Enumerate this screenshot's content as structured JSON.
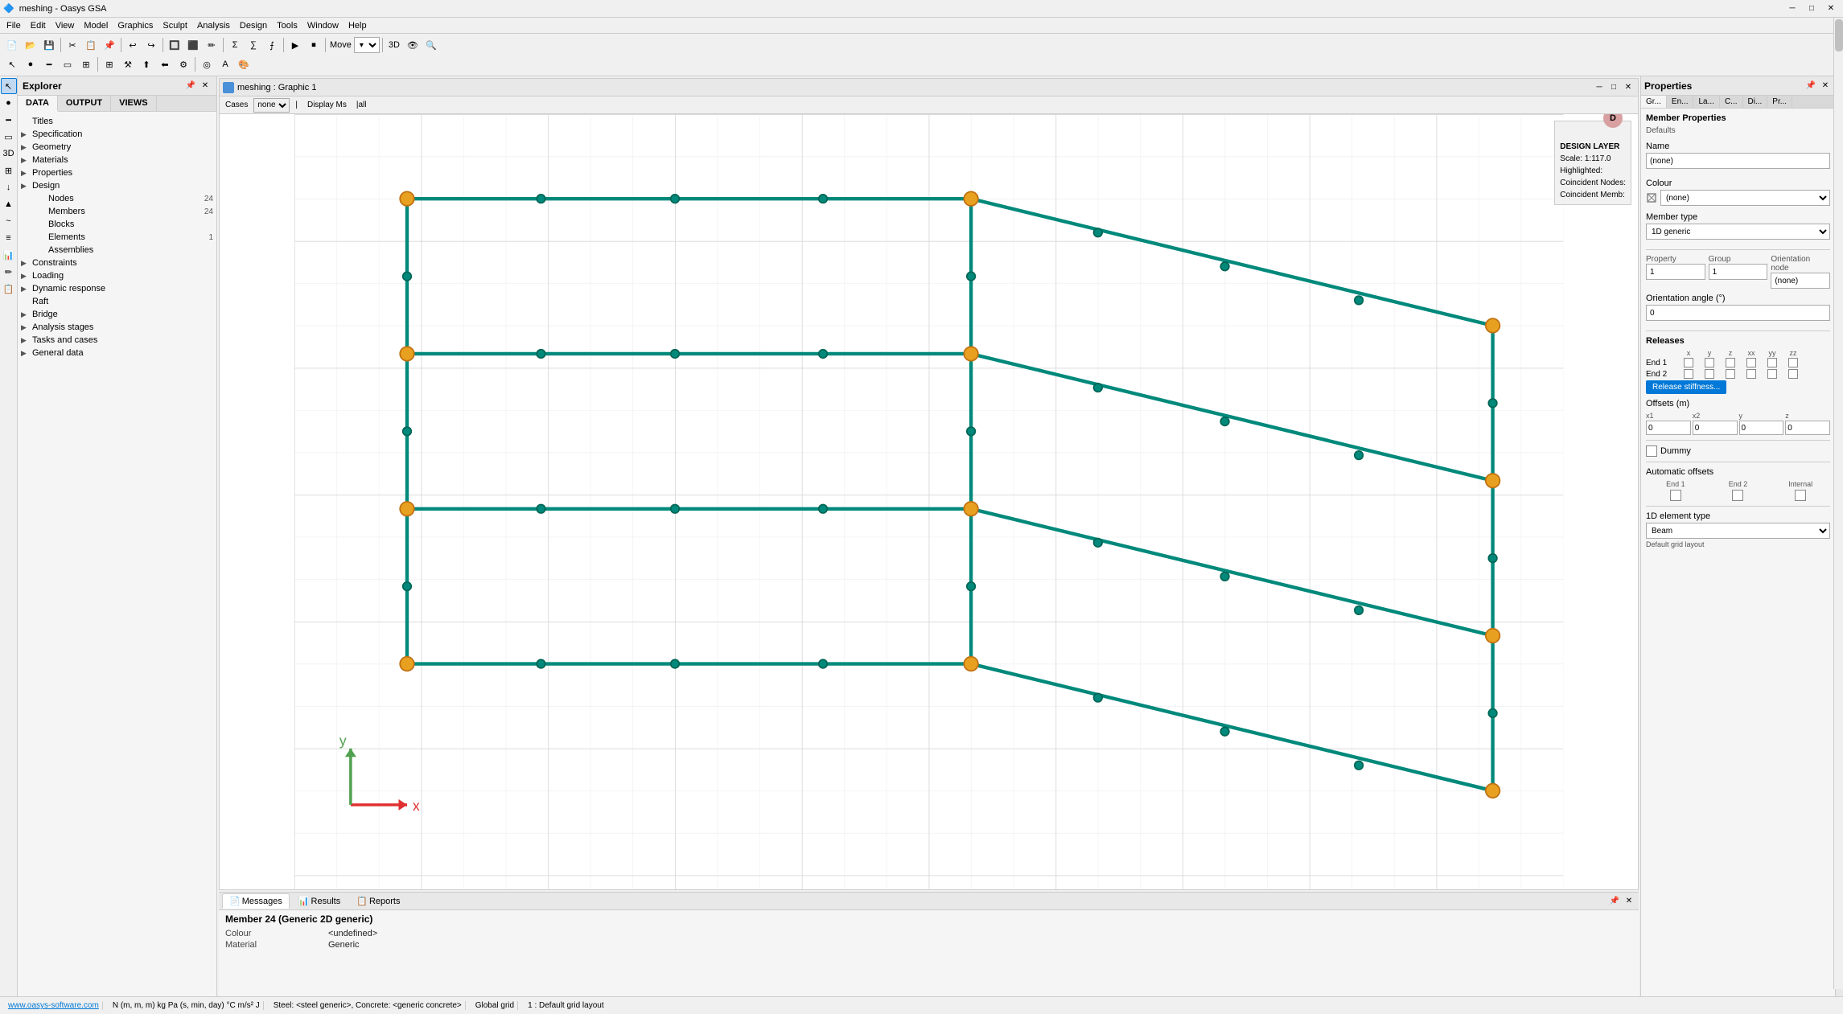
{
  "app": {
    "title": "meshing - Oasys GSA",
    "icon": "🔷"
  },
  "titlebar": {
    "title": "meshing - Oasys GSA",
    "minimize": "─",
    "maximize": "□",
    "close": "✕"
  },
  "menubar": {
    "items": [
      "File",
      "Edit",
      "View",
      "Model",
      "Graphics",
      "Sculpt",
      "Analysis",
      "Design",
      "Tools",
      "Window",
      "Help"
    ]
  },
  "explorer": {
    "title": "Explorer",
    "tabs": [
      "DATA",
      "OUTPUT",
      "VIEWS"
    ],
    "active_tab": "DATA",
    "tree": [
      {
        "label": "Titles",
        "indent": 0,
        "hasArrow": false,
        "count": ""
      },
      {
        "label": "Specification",
        "indent": 0,
        "hasArrow": true,
        "count": ""
      },
      {
        "label": "Geometry",
        "indent": 0,
        "hasArrow": true,
        "count": ""
      },
      {
        "label": "Materials",
        "indent": 0,
        "hasArrow": true,
        "count": ""
      },
      {
        "label": "Properties",
        "indent": 0,
        "hasArrow": true,
        "count": ""
      },
      {
        "label": "Design",
        "indent": 0,
        "hasArrow": true,
        "count": ""
      },
      {
        "label": "Nodes",
        "indent": 1,
        "hasArrow": false,
        "count": "24"
      },
      {
        "label": "Members",
        "indent": 1,
        "hasArrow": false,
        "count": "24"
      },
      {
        "label": "Blocks",
        "indent": 1,
        "hasArrow": false,
        "count": ""
      },
      {
        "label": "Elements",
        "indent": 1,
        "hasArrow": false,
        "count": "1"
      },
      {
        "label": "Assemblies",
        "indent": 1,
        "hasArrow": false,
        "count": ""
      },
      {
        "label": "Constraints",
        "indent": 0,
        "hasArrow": true,
        "count": ""
      },
      {
        "label": "Loading",
        "indent": 0,
        "hasArrow": true,
        "count": ""
      },
      {
        "label": "Dynamic response",
        "indent": 0,
        "hasArrow": true,
        "count": ""
      },
      {
        "label": "Raft",
        "indent": 0,
        "hasArrow": false,
        "count": ""
      },
      {
        "label": "Bridge",
        "indent": 0,
        "hasArrow": true,
        "count": ""
      },
      {
        "label": "Analysis stages",
        "indent": 0,
        "hasArrow": true,
        "count": ""
      },
      {
        "label": "Tasks and cases",
        "indent": 0,
        "hasArrow": true,
        "count": ""
      },
      {
        "label": "General data",
        "indent": 0,
        "hasArrow": true,
        "count": ""
      }
    ]
  },
  "graphic": {
    "title": "meshing : Graphic 1",
    "cases_label": "Cases",
    "cases_value": "none",
    "display_label": "Display Ms",
    "design_layer": {
      "label": "DESIGN LAYER",
      "scale": "Scale: 1:117.0",
      "highlighted": "Highlighted:",
      "coincident_nodes": "Coincident Nodes:",
      "coincident_members": "Coincident Memb:"
    }
  },
  "messages": {
    "panel_title": "Messages",
    "tabs": [
      "Messages",
      "Results",
      "Reports"
    ],
    "active_tab": "Messages",
    "member_title": "Member 24 (Generic 2D generic)",
    "rows": [
      {
        "label": "Colour",
        "value": "<undefined>"
      },
      {
        "label": "Material",
        "value": "Generic"
      }
    ]
  },
  "properties": {
    "panel_title": "Properties",
    "section_title": "Member Properties",
    "defaults": "Defaults",
    "tabs": [
      "Gr...",
      "En...",
      "La...",
      "C...",
      "Di...",
      "Pr..."
    ],
    "active_tab": "Gr...",
    "name_label": "Name",
    "name_value": "(none)",
    "colour_label": "Colour",
    "colour_value": "(none)",
    "member_type_label": "Member type",
    "member_type_value": "1D generic",
    "property_label": "Property",
    "property_value": "1",
    "group_label": "Group",
    "group_value": "1",
    "orientation_node_label": "Orientation node",
    "orientation_node_value": "(none)",
    "orientation_angle_label": "Orientation angle (°)",
    "orientation_angle_value": "0",
    "releases_label": "Releases",
    "releases_headers": [
      "x",
      "y",
      "z",
      "xx",
      "yy",
      "zz"
    ],
    "end1_label": "End 1",
    "end2_label": "End 2",
    "release_stiffness_btn": "Release stiffness...",
    "offsets_label": "Offsets (m)",
    "offsets": {
      "x1_label": "x1",
      "x1_value": "0",
      "x2_label": "x2",
      "x2_value": "0",
      "y_label": "y",
      "y_value": "0",
      "z_label": "z",
      "z_value": "0"
    },
    "dummy_label": "Dummy",
    "auto_offsets_label": "Automatic offsets",
    "auto_offsets_cols": [
      "End 1",
      "End 2",
      "Internal"
    ],
    "elem_type_label": "1D element type",
    "elem_type_value": "Beam",
    "elem_type_sub": "Default grid layout"
  },
  "statusbar": {
    "website": "www.oasys-software.com",
    "units": "N  (m, m, m)  kg  Pa  (s, min, day)  °C  m/s²  J",
    "materials": "Steel: <steel generic>,  Concrete: <generic concrete>",
    "grid": "Global grid",
    "layout": "1 : Default grid layout"
  }
}
